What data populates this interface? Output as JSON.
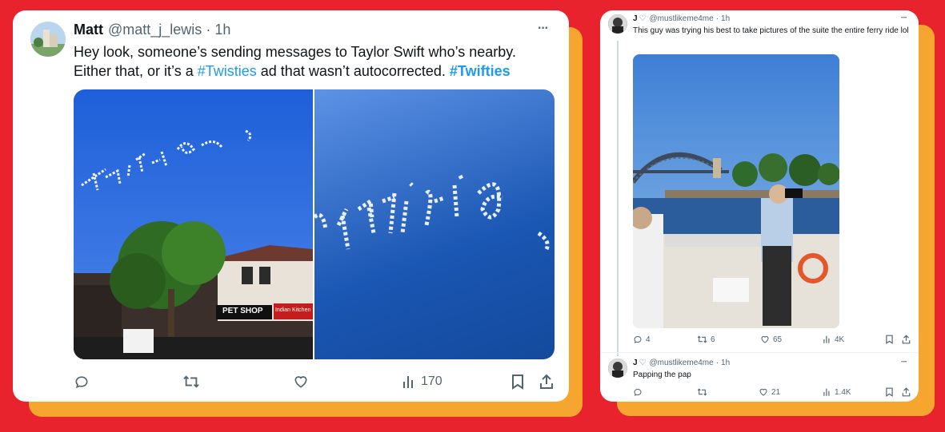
{
  "left_tweet": {
    "name": "Matt",
    "handle": "@matt_j_lewis",
    "separator": "·",
    "time": "1h",
    "more": "···",
    "text_line1": "Hey look, someone’s sending messages to Taylor Swift who’s nearby.",
    "text_line2_pre": "Either that, or it’s a ",
    "hashtag1": "#Twisties",
    "text_line2_mid": " ad that wasn’t autocorrected. ",
    "hashtag2": "#Twifties",
    "image_left_skytext": "Twiftie",
    "image_right_skytext": "Twiftie",
    "shop_sign": "PET SHOP",
    "restaurant_sign": "Indian Kitchen",
    "views": "170"
  },
  "right_thread": {
    "tweet1": {
      "name": "J",
      "handle": "@mustlikeme4me",
      "separator": "·",
      "time": "1h",
      "more": "···",
      "text": "This guy was trying his best to take pictures of the suite the entire ferry ride lol",
      "replies": "4",
      "reposts": "6",
      "likes": "65",
      "views": "4K"
    },
    "tweet2": {
      "name": "J",
      "handle": "@mustlikeme4me",
      "separator": "·",
      "time": "1h",
      "more": "···",
      "text": "Papping the pap",
      "reposts": "",
      "likes": "21",
      "views": "1.4K"
    }
  },
  "colors": {
    "background": "#e8232d",
    "shadow": "#f6a62f",
    "hashtag": "#1d9bf0",
    "muted": "#536471"
  }
}
